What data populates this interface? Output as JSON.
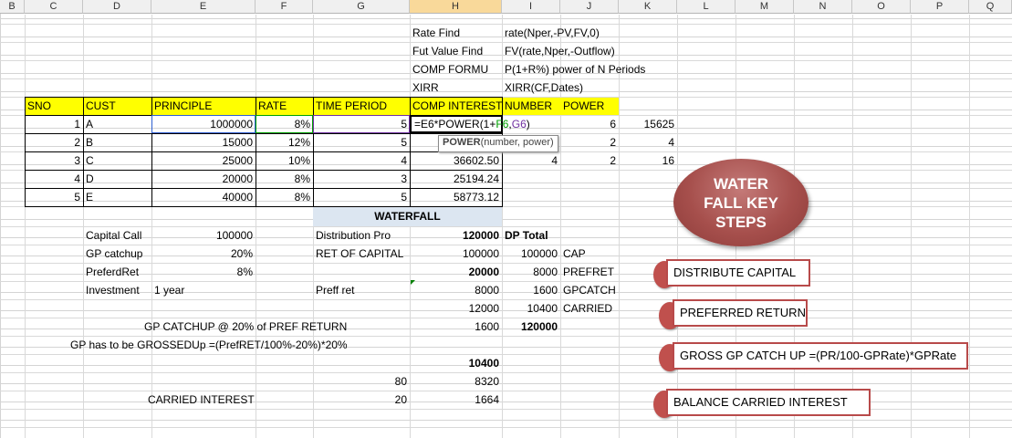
{
  "columns": [
    "B",
    "C",
    "D",
    "E",
    "F",
    "G",
    "H",
    "I",
    "J",
    "K",
    "L",
    "M",
    "N",
    "O",
    "P",
    "Q"
  ],
  "selected_column": "H",
  "formula_notes": [
    {
      "label": "Rate Find",
      "text": "rate(Nper,-PV,FV,0)"
    },
    {
      "label": "Fut Value Find",
      "text": "FV(rate,Nper,-Outflow)"
    },
    {
      "label": "COMP FORMU",
      "text": " P(1+R%) power of N Periods"
    },
    {
      "label": "XIRR",
      "text": "XIRR(CF,Dates)"
    }
  ],
  "table": {
    "headers": [
      "SNO",
      "CUST",
      "PRINCIPLE",
      "RATE",
      "TIME PERIOD",
      "COMP INTEREST",
      "NUMBER",
      "POWER"
    ],
    "rows": [
      {
        "sno": "1",
        "cust": "A",
        "principle": "1000000",
        "rate": "8%",
        "period": "5",
        "comp": "=E6*POWER(1+F6,G6)",
        "number": "6",
        "power": "15625"
      },
      {
        "sno": "2",
        "cust": "B",
        "principle": "15000",
        "rate": "12%",
        "period": "5",
        "comp": "",
        "number": "2",
        "power": "4"
      },
      {
        "sno": "3",
        "cust": "C",
        "principle": "25000",
        "rate": "10%",
        "period": "4",
        "comp": "36602.50",
        "number": "4",
        "power": "2",
        "extra": "16"
      },
      {
        "sno": "4",
        "cust": "D",
        "principle": "20000",
        "rate": "8%",
        "period": "3",
        "comp": "25194.24"
      },
      {
        "sno": "5",
        "cust": "E",
        "principle": "40000",
        "rate": "8%",
        "period": "5",
        "comp": "58773.12"
      }
    ]
  },
  "formula_parts": {
    "p1": "=E6*POWER(1+",
    "p2": "F6",
    "p3": ",",
    "p4": "G6",
    "p5": ")"
  },
  "tooltip": {
    "fn": "POWER",
    "args": "(number, power)"
  },
  "waterfall": {
    "title": "WATERFALL",
    "inputs": [
      {
        "label": "Capital Call",
        "value": "100000"
      },
      {
        "label": "GP catchup",
        "value": "20%"
      },
      {
        "label": "PreferdRet",
        "value": "8%"
      },
      {
        "label": "Investment",
        "value": "1 year"
      }
    ],
    "g_labels": {
      "dist": "Distribution Pro",
      "ret": "RET OF CAPITAL",
      "pref": "Preff ret"
    },
    "h_values": [
      "120000",
      "100000",
      "20000",
      "8000",
      "12000",
      "1600",
      "",
      "10400",
      "8320",
      "1664"
    ],
    "i_values": {
      "dp_total": "DP Total",
      "cap_val": "100000",
      "pref_val": "8000",
      "gp_val": "1600",
      "car_val": "10400",
      "total": "120000"
    },
    "j_labels": {
      "cap": "CAP",
      "pref": "PREFRET",
      "gp": "GPCATCH",
      "car": "CARRIED"
    },
    "gp_catchup_text": "GP CATCHUP  @ 20% of PREF RETURN",
    "grossed_text": "GP has to be GROSSEDUp =(PrefRET/100%-20%)*20%",
    "g_80": "80",
    "g_20": "20",
    "carried_label": "CARRIED INTEREST"
  },
  "callout": {
    "title": "WATER FALL KEY STEPS"
  },
  "steps": [
    "DISTRIBUTE  CAPITAL",
    "PREFERRED RETURN",
    "GROSS GP CATCH UP =(PR/100-GPRate)*GPRate",
    "BALANCE CARRIED  INTEREST"
  ],
  "colors": {
    "header_yellow": "#ffff00",
    "accent_red": "#c0504d",
    "callout": "#a64f4c",
    "f_ref": "#00a000",
    "g_ref": "#7030a0"
  }
}
